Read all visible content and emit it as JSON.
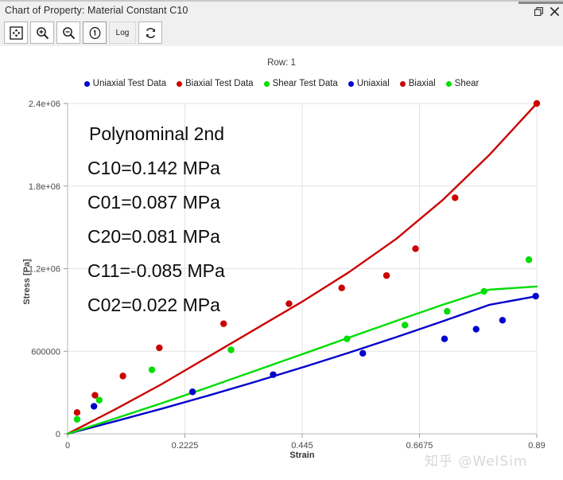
{
  "window": {
    "title": "Chart of Property: Material Constant C10",
    "restore_icon": "restore-icon",
    "close_icon": "close-icon"
  },
  "toolbar": {
    "buttons": [
      {
        "name": "fit-to-window-button",
        "icon": "fit-icon",
        "label": ""
      },
      {
        "name": "zoom-in-button",
        "icon": "zoom-in-icon",
        "label": ""
      },
      {
        "name": "zoom-out-button",
        "icon": "zoom-out-icon",
        "label": ""
      },
      {
        "name": "info-button",
        "icon": "info-icon",
        "label": ""
      },
      {
        "name": "log-scale-button",
        "icon": "text-icon",
        "label": "Log"
      },
      {
        "name": "refresh-button",
        "icon": "refresh-icon",
        "label": ""
      }
    ],
    "log_label": "Log"
  },
  "chart": {
    "row_label": "Row: 1",
    "legend": [
      {
        "label": "Uniaxial Test Data",
        "color": "#0000cc",
        "marker": "dot"
      },
      {
        "label": "Biaxial Test Data",
        "color": "#cc0000",
        "marker": "dot"
      },
      {
        "label": "Shear Test Data",
        "color": "#00dd00",
        "marker": "dot"
      },
      {
        "label": "Uniaxial",
        "color": "#0000cc",
        "marker": "dot"
      },
      {
        "label": "Biaxial",
        "color": "#cc0000",
        "marker": "dot"
      },
      {
        "label": "Shear",
        "color": "#00dd00",
        "marker": "dot"
      }
    ],
    "annotation": [
      "Polynominal 2nd",
      "C10=0.142 MPa",
      "C01=0.087 MPa",
      "C20=0.081 MPa",
      "C11=-0.085 MPa",
      "C02=0.022 MPa"
    ],
    "watermark": "知乎 @WelSim"
  },
  "chart_data": {
    "type": "scatter",
    "title": "",
    "xlabel": "Strain",
    "ylabel": "Stress [Pa]",
    "xlim": [
      0,
      0.89
    ],
    "ylim": [
      0,
      2400000
    ],
    "xticks": [
      0,
      0.2225,
      0.445,
      0.6675,
      0.89
    ],
    "xtick_labels": [
      "0",
      "0.2225",
      "0.445",
      "0.6675",
      "0.89"
    ],
    "yticks": [
      0,
      600000,
      1200000,
      1800000,
      2400000
    ],
    "ytick_labels": [
      "0",
      "600000",
      "1.2e+06",
      "1.8e+06",
      "2.4e+06"
    ],
    "grid": true,
    "legend_position": "top",
    "series": [
      {
        "name": "Uniaxial Test Data",
        "type": "scatter",
        "color": "#0000cc",
        "points": [
          [
            0.05,
            200000
          ],
          [
            0.237,
            305000
          ],
          [
            0.39,
            430000
          ],
          [
            0.56,
            585000
          ],
          [
            0.715,
            690000
          ],
          [
            0.775,
            760000
          ],
          [
            0.825,
            825000
          ],
          [
            0.888,
            1000000
          ]
        ]
      },
      {
        "name": "Biaxial Test Data",
        "type": "scatter",
        "color": "#cc0000",
        "points": [
          [
            0.018,
            155000
          ],
          [
            0.052,
            280000
          ],
          [
            0.105,
            420000
          ],
          [
            0.174,
            625000
          ],
          [
            0.296,
            800000
          ],
          [
            0.42,
            945000
          ],
          [
            0.52,
            1060000
          ],
          [
            0.605,
            1150000
          ],
          [
            0.66,
            1345000
          ],
          [
            0.735,
            1715000
          ],
          [
            0.89,
            2400000
          ]
        ]
      },
      {
        "name": "Shear Test Data",
        "type": "scatter",
        "color": "#00dd00",
        "points": [
          [
            0.018,
            105000
          ],
          [
            0.06,
            245000
          ],
          [
            0.16,
            465000
          ],
          [
            0.31,
            610000
          ],
          [
            0.53,
            690000
          ],
          [
            0.64,
            790000
          ],
          [
            0.72,
            890000
          ],
          [
            0.79,
            1035000
          ],
          [
            0.875,
            1265000
          ]
        ]
      },
      {
        "name": "Uniaxial",
        "type": "line",
        "color": "#0000cc",
        "points": [
          [
            0.0,
            0
          ],
          [
            0.089,
            90000
          ],
          [
            0.178,
            182000
          ],
          [
            0.267,
            278000
          ],
          [
            0.356,
            378000
          ],
          [
            0.445,
            482000
          ],
          [
            0.534,
            590000
          ],
          [
            0.623,
            702000
          ],
          [
            0.712,
            818000
          ],
          [
            0.801,
            938000
          ],
          [
            0.89,
            1000000
          ]
        ]
      },
      {
        "name": "Biaxial",
        "type": "line",
        "color": "#cc0000",
        "points": [
          [
            0.0,
            0
          ],
          [
            0.089,
            175000
          ],
          [
            0.178,
            360000
          ],
          [
            0.267,
            560000
          ],
          [
            0.356,
            760000
          ],
          [
            0.445,
            960000
          ],
          [
            0.534,
            1175000
          ],
          [
            0.623,
            1415000
          ],
          [
            0.712,
            1700000
          ],
          [
            0.801,
            2030000
          ],
          [
            0.89,
            2400000
          ]
        ]
      },
      {
        "name": "Shear",
        "type": "line",
        "color": "#00dd00",
        "points": [
          [
            0.0,
            0
          ],
          [
            0.089,
            110000
          ],
          [
            0.178,
            222000
          ],
          [
            0.267,
            338000
          ],
          [
            0.356,
            458000
          ],
          [
            0.445,
            578000
          ],
          [
            0.534,
            700000
          ],
          [
            0.623,
            820000
          ],
          [
            0.712,
            938000
          ],
          [
            0.801,
            1048000
          ],
          [
            0.89,
            1070000
          ]
        ]
      }
    ]
  }
}
